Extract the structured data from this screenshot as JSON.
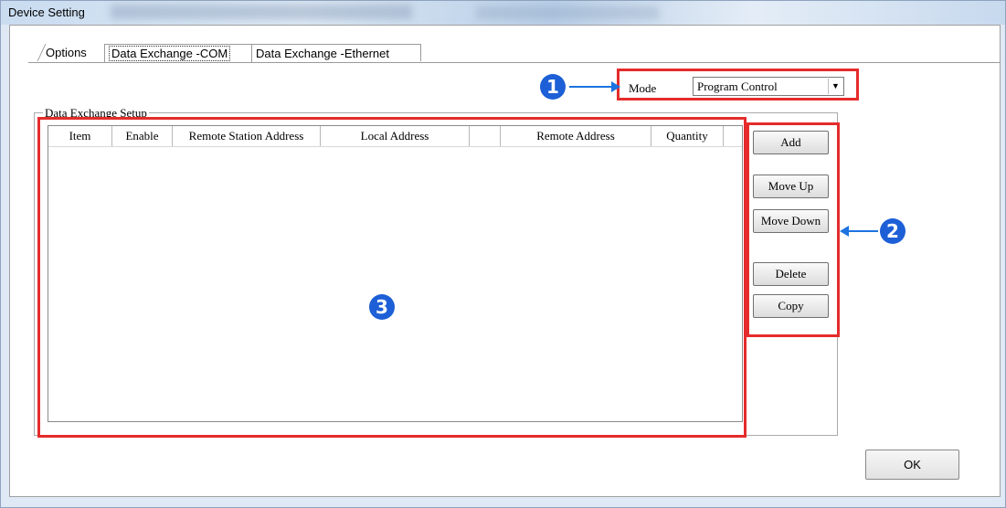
{
  "window": {
    "title": "Device Setting"
  },
  "tabs": [
    {
      "label": "Options"
    },
    {
      "label": "Data Exchange -COM"
    },
    {
      "label": "Data Exchange -Ethernet"
    }
  ],
  "mode": {
    "label": "Mode",
    "value": "Program Control"
  },
  "group": {
    "title": "Data Exchange Setup"
  },
  "table": {
    "columns": [
      "Item",
      "Enable",
      "Remote Station Address",
      "Local Address",
      "",
      "Remote Address",
      "Quantity"
    ],
    "rows": []
  },
  "buttons": {
    "add": "Add",
    "move_up": "Move Up",
    "move_down": "Move Down",
    "delete": "Delete",
    "copy": "Copy",
    "ok": "OK"
  },
  "annotations": {
    "one": "1",
    "two": "2",
    "three": "3"
  },
  "colors": {
    "highlight": "#e52b2b",
    "callout": "#1d5fd6"
  }
}
